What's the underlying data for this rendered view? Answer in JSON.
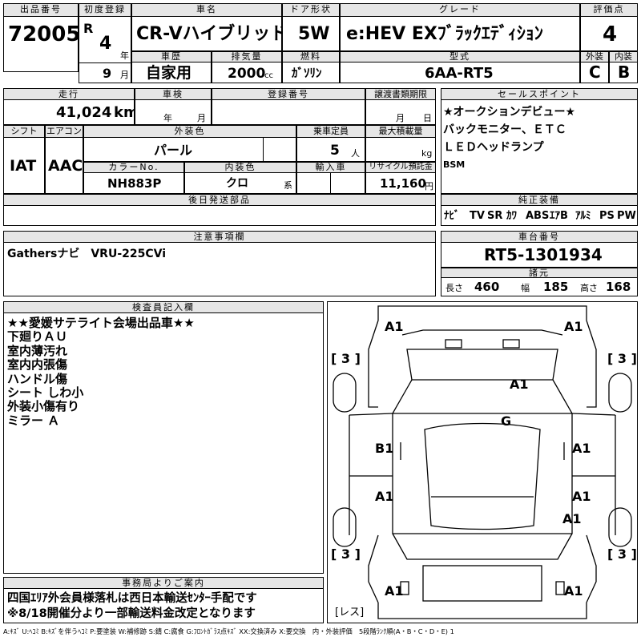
{
  "sheet": {
    "lot_number_label": "出品番号",
    "lot_number": "72005",
    "first_reg_label": "初度登録",
    "era": "R",
    "year": "4",
    "year_unit": "年",
    "month": "9",
    "month_unit": "月",
    "car_name_label": "車名",
    "car_name": "CR-Vハイブリッド",
    "history_label": "車歴",
    "history": "自家用",
    "displacement_label": "排気量",
    "displacement": "2000",
    "displacement_unit": "cc",
    "door_label": "ドア形状",
    "door": "5W",
    "fuel_label": "燃料",
    "fuel": "ｶﾞｿﾘﾝ",
    "grade_label": "グレード",
    "grade": "e:HEV EXﾌﾞﾗｯｸｴﾃﾞｨｼｮﾝ",
    "model_code_label": "型式",
    "model_code": "6AA-RT5",
    "score_label": "評価点",
    "score": "4",
    "exterior_label": "外装",
    "exterior": "C",
    "interior_label": "内装",
    "interior": "B",
    "mileage_label": "走行",
    "mileage": "41,024",
    "mileage_unit": "km",
    "inspection_label": "車検",
    "inspection_year_unit": "年",
    "inspection_month_unit": "月",
    "reg_number_label": "登録番号",
    "transfer_label": "譲渡書類期限",
    "transfer_month_unit": "月",
    "transfer_day_unit": "日",
    "shift_label": "シフト",
    "shift": "IAT",
    "ac_label": "エアコン",
    "ac": "AAC",
    "ext_color_label": "外装色",
    "ext_color": "パール",
    "capacity_label": "乗車定員",
    "capacity": "5",
    "capacity_unit": "人",
    "load_label": "最大積載量",
    "load_unit": "kg",
    "color_no_label": "カラーNo.",
    "color_no": "NH883P",
    "int_color_label": "内装色",
    "int_color": "クロ",
    "int_color_unit": "系",
    "import_label": "輸入車",
    "recycle_label": "リサイクル預託金",
    "recycle": "11,160",
    "recycle_unit": "円",
    "later_parts_label": "後日発送部品",
    "sales_point_label": "セールスポイント",
    "sales_points": [
      "★オークションデビュー★",
      "バックモニター、ＥＴＣ",
      "ＬＥＤヘッドランプ",
      "BSM"
    ],
    "equipment_label": "純正装備",
    "equipment": [
      "ﾅﾋﾞ",
      "TV",
      "SR",
      "ｶﾜ",
      "ABS",
      "ｴｱB",
      "ｱﾙﾐ",
      "PS",
      "PW"
    ],
    "caution_label": "注意事項欄",
    "caution": "Gathersナビ　VRU-225CVi",
    "chassis_label": "車台番号",
    "chassis": "RT5-1301934",
    "dims_label": "諸元",
    "length_label": "長さ",
    "length": "460",
    "width_label": "幅",
    "width": "185",
    "height_label": "高さ",
    "height": "168",
    "inspector_label": "検査員記入欄",
    "inspector_notes": [
      "★★愛媛サテライト会場出品車★★",
      "下廻りＡＵ",
      "室内薄汚れ",
      "室内内張傷",
      "ハンドル傷",
      "シート しわ小",
      "外装小傷有り",
      "ミラー Ａ"
    ],
    "office_label": "事務局よりご案内",
    "office_notes": [
      "四国ｴﾘｱ外会員様落札は西日本輸送ｾﾝﾀｰ手配です",
      "※8/18開催分より一部輸送料金改定となります"
    ],
    "legend": "A:ｷｽﾞ U:ﾍｺﾐ B:ｷｽﾞを伴うﾍｺﾐ P:要塗装 W:補修跡 S:錆 C:腐食 G:ﾌﾛﾝﾄｶﾞﾗｽ点ｷｽﾞ XX:交換済み X:要交換　内・外装評価　5段階ﾗﾝｸ順(A・B・C・D・E) 1"
  },
  "damage_map": {
    "front_left": "A1",
    "front_right": "A1",
    "front_left_tire": "[ 3 ]",
    "front_right_tire": "[ 3 ]",
    "hood": "A1",
    "windshield": "G",
    "left_front_door": "B1",
    "right_front_door": "A1",
    "left_rear_door": "A1",
    "right_rear_door": "A1",
    "right_rear_fender": "A1",
    "rear_left_tire": "[ 3 ]",
    "rear_right_tire": "[ 3 ]",
    "rear_left": "A1",
    "rear_right": "A1",
    "spare_tire": "[レス]"
  }
}
